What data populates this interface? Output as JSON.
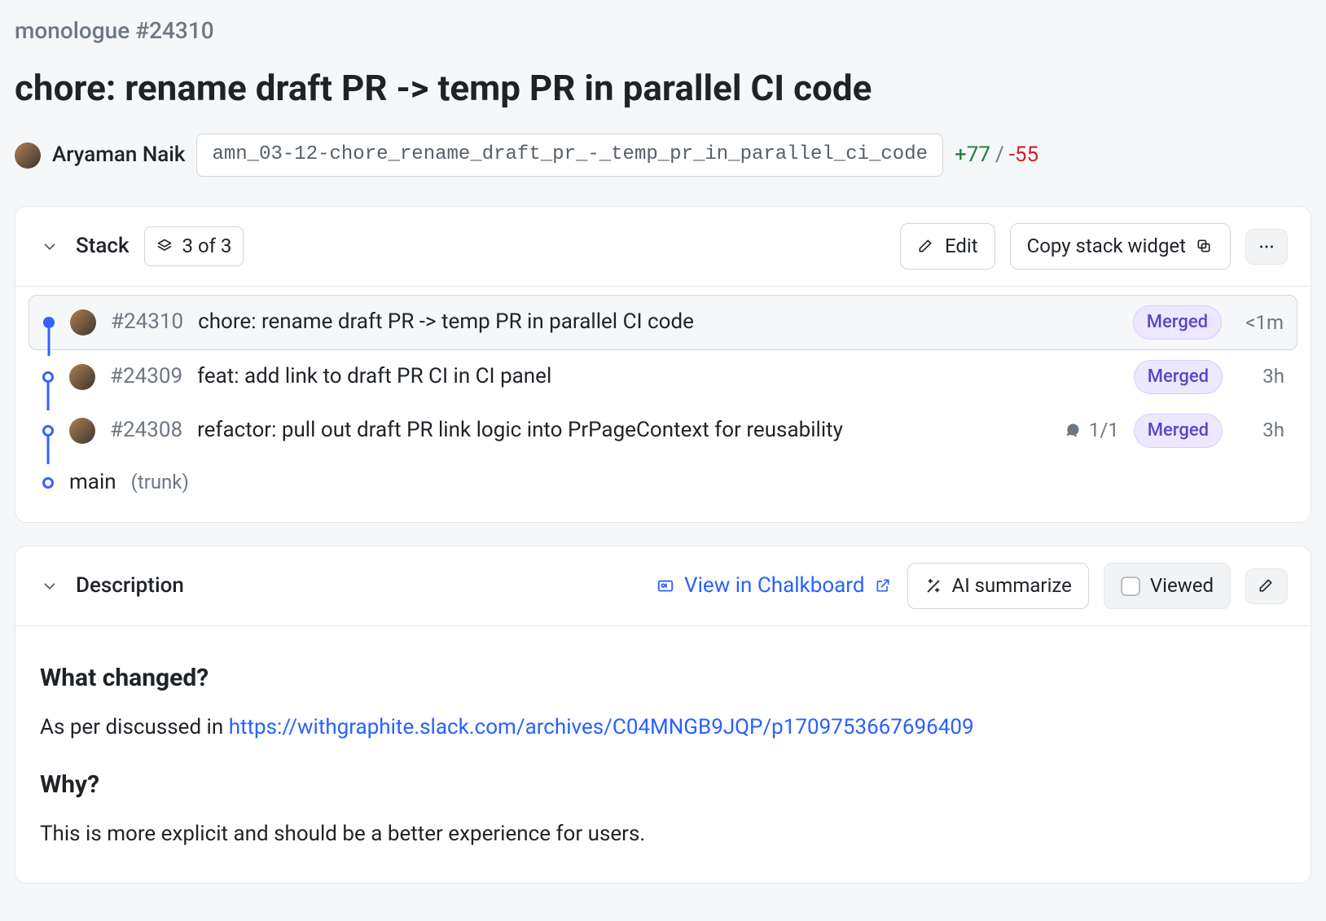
{
  "repo": {
    "name": "monologue",
    "number": "#24310"
  },
  "title": "chore: rename draft PR -> temp PR in parallel CI code",
  "author": "Aryaman Naik",
  "branch": "amn_03-12-chore_rename_draft_pr_-_temp_pr_in_parallel_ci_code",
  "diff": {
    "additions": "+77",
    "separator": "/",
    "deletions": "-55"
  },
  "stack": {
    "label": "Stack",
    "count_label": "3 of 3",
    "edit_label": "Edit",
    "copy_label": "Copy stack widget",
    "items": [
      {
        "id": "#24310",
        "title": "chore: rename draft PR -> temp PR in parallel CI code",
        "status": "Merged",
        "time": "<1m",
        "comments": ""
      },
      {
        "id": "#24309",
        "title": "feat: add link to draft PR CI in CI panel",
        "status": "Merged",
        "time": "3h",
        "comments": ""
      },
      {
        "id": "#24308",
        "title": "refactor: pull out draft PR link logic into PrPageContext for reusability",
        "status": "Merged",
        "time": "3h",
        "comments": "1/1"
      }
    ],
    "base": {
      "name": "main",
      "note": "(trunk)"
    }
  },
  "description": {
    "label": "Description",
    "chalkboard_label": "View in Chalkboard",
    "ai_label": "AI summarize",
    "viewed_label": "Viewed",
    "heading1": "What changed?",
    "para1_prefix": "As per discussed in ",
    "para1_link": "https://withgraphite.slack.com/archives/C04MNGB9JQP/p1709753667696409",
    "heading2": "Why?",
    "para2": "This is more explicit and should be a better experience for users."
  }
}
